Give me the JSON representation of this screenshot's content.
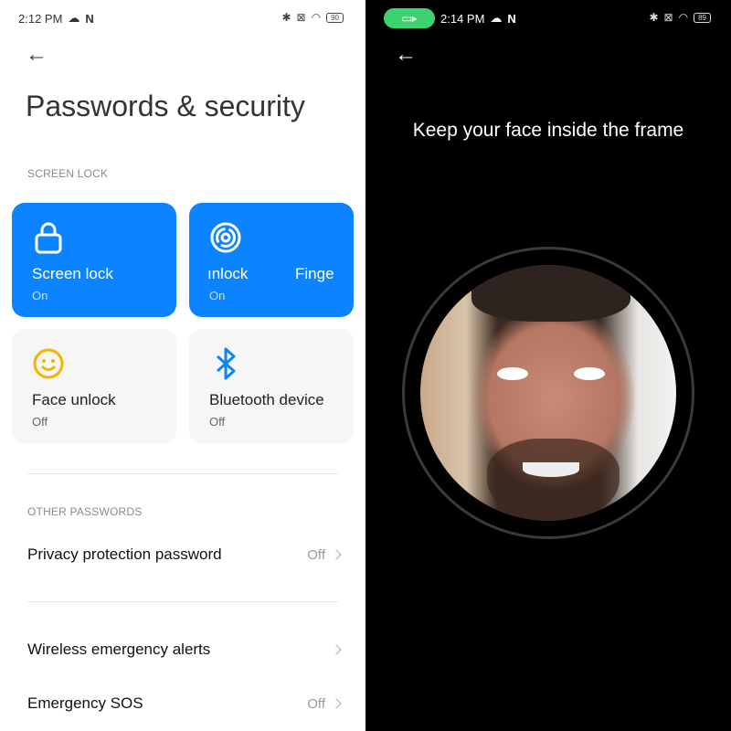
{
  "left": {
    "status": {
      "time": "2:12 PM",
      "battery": "90"
    },
    "title": "Passwords & security",
    "screen_lock_header": "SCREEN LOCK",
    "cards": [
      {
        "label": "Screen lock",
        "status": "On",
        "icon": "lock-icon"
      },
      {
        "label": "ınlock",
        "label2": "Finge",
        "status": "On",
        "icon": "fingerprint-icon"
      },
      {
        "label": "Face unlock",
        "status": "Off",
        "icon": "smiley-face-icon"
      },
      {
        "label": "Bluetooth device",
        "status": "Off",
        "icon": "bluetooth-icon"
      }
    ],
    "other_header": "OTHER PASSWORDS",
    "rows": [
      {
        "label": "Privacy protection password",
        "value": "Off"
      },
      {
        "label": "Wireless emergency alerts",
        "value": ""
      },
      {
        "label": "Emergency SOS",
        "value": "Off"
      }
    ],
    "colors": {
      "accent": "#0d84ff",
      "face_icon": "#f5b400"
    }
  },
  "right": {
    "status": {
      "time": "2:14 PM",
      "battery": "89"
    },
    "prompt": "Keep your face inside the frame",
    "colors": {
      "recording_pill": "#3dd26f"
    }
  }
}
